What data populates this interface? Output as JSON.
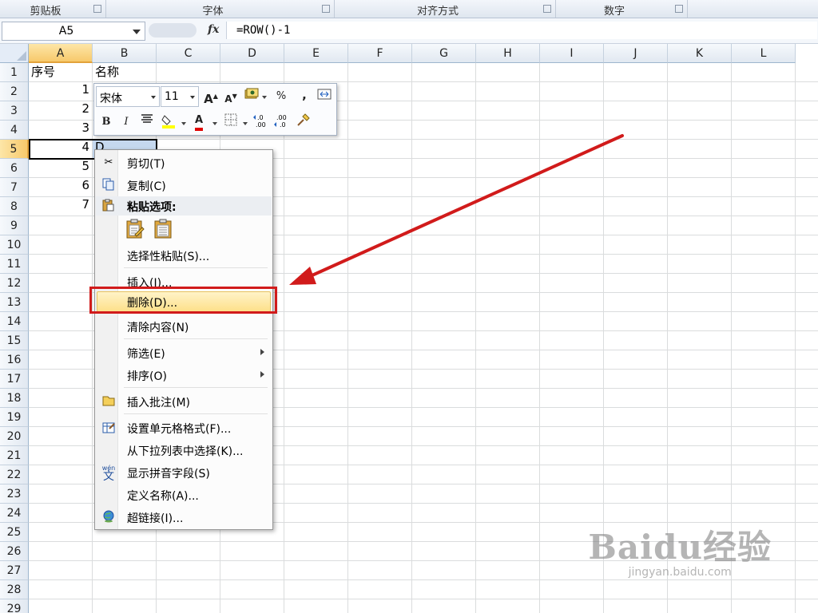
{
  "ribbon": {
    "groups": [
      {
        "label": "剪贴板"
      },
      {
        "label": "字体"
      },
      {
        "label": "对齐方式"
      },
      {
        "label": "数字"
      }
    ]
  },
  "formula_bar": {
    "name_box": "A5",
    "fx": "fx",
    "formula": "=ROW()-1"
  },
  "columns": [
    "A",
    "B",
    "C",
    "D",
    "E",
    "F",
    "G",
    "H",
    "I",
    "J",
    "K",
    "L"
  ],
  "selected_column": "A",
  "rows": [
    "1",
    "2",
    "3",
    "4",
    "5",
    "6",
    "7",
    "8",
    "9",
    "10",
    "11",
    "12",
    "13",
    "14",
    "15",
    "16",
    "17",
    "18",
    "19",
    "20",
    "21",
    "22",
    "23",
    "24",
    "25",
    "26",
    "27",
    "28",
    "29"
  ],
  "selected_row": "5",
  "cells": {
    "header_a": "序号",
    "header_b": "名称",
    "a_values": [
      "1",
      "2",
      "3",
      "4",
      "5",
      "6",
      "7"
    ],
    "b5_partial": "D"
  },
  "mini_toolbar": {
    "font_name": "宋体",
    "font_size": "11",
    "grow_font": "A",
    "shrink_font": "A",
    "percent": "%",
    "comma": ",",
    "bold": "B",
    "italic": "I",
    "font_color_letter": "A",
    "highlight_color": "#ffff00",
    "font_color": "#e00000"
  },
  "context_menu": {
    "items": {
      "cut": "剪切(T)",
      "copy": "复制(C)",
      "paste_options": "粘贴选项:",
      "paste_special": "选择性粘贴(S)...",
      "insert": "插入(I)...",
      "delete": "删除(D)...",
      "clear_contents": "清除内容(N)",
      "filter": "筛选(E)",
      "sort": "排序(O)",
      "insert_comment": "插入批注(M)",
      "format_cells": "设置单元格格式(F)...",
      "pick_from_list": "从下拉列表中选择(K)...",
      "phonetic": "显示拼音字段(S)",
      "define_name": "定义名称(A)...",
      "hyperlink": "超链接(I)..."
    },
    "phonetic_icon_text": "wén",
    "highlighted_item": "delete"
  },
  "annotation": {
    "color": "#d11b1b"
  },
  "watermark": {
    "logo": "Baidu经验",
    "url": "jingyan.baidu.com"
  }
}
